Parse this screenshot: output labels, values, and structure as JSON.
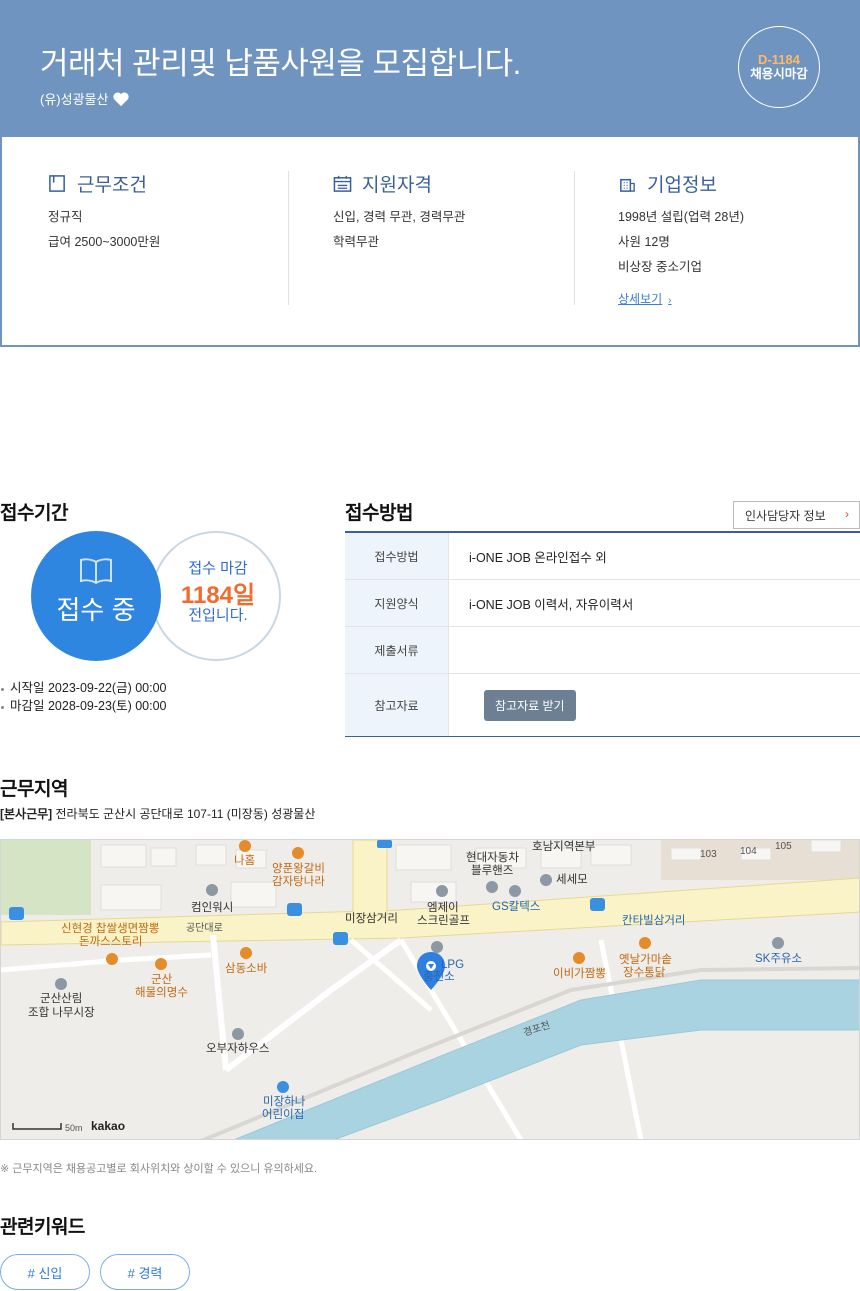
{
  "header": {
    "title": "거래처 관리및 납품사원을 모집합니다.",
    "company": "(유)성광물산",
    "dday": "D-1184",
    "dday_label": "채용시마감"
  },
  "summary": {
    "conditions": {
      "title": "근무조건",
      "lines": [
        "정규직",
        "급여 2500~3000만원"
      ]
    },
    "qualification": {
      "title": "지원자격",
      "lines": [
        "신입, 경력 무관, 경력무관",
        "학력무관"
      ]
    },
    "company_info": {
      "title": "기업정보",
      "lines": [
        "1998년 설립(업력 28년)",
        "사원 12명",
        "비상장 중소기업"
      ],
      "more": "상세보기"
    }
  },
  "period": {
    "title": "접수기간",
    "status": "접수 중",
    "deadline_line1": "접수 마감",
    "deadline_days": "1184일",
    "deadline_line3": "전입니다.",
    "start": "시작일 2023-09-22(금) 00:00",
    "end": "마감일 2028-09-23(토) 00:00"
  },
  "method": {
    "title": "접수방법",
    "hr_button": "인사담당자 정보",
    "rows": [
      {
        "label": "접수방법",
        "value": "i-ONE JOB 온라인접수 외"
      },
      {
        "label": "지원양식",
        "value": "i-ONE JOB 이력서, 자유이력서"
      },
      {
        "label": "제출서류",
        "value": ""
      },
      {
        "label": "참고자료",
        "button": "참고자료 받기"
      }
    ]
  },
  "location": {
    "title": "근무지역",
    "tag": "[본사근무]",
    "address": "전라북도 군산시 공단대로 107-11 (미장동) 성광물산",
    "note": "※ 근무지역은 채용공고별로 회사위치와 상이할 수 있으니 유의하세요.",
    "map": {
      "labels": {
        "nahom": "나홈",
        "yangpung": "양푼왕갈비",
        "gamjatang": "감자탕나라",
        "hyundai": "현대자동차",
        "bluehands": "블루핸즈",
        "honam": "호남지역본부",
        "bld103": "103",
        "bld104": "104",
        "bld105": "105",
        "sesemo": "세세모",
        "computer": "컴인워시",
        "mijang_sam": "미장삼거리",
        "mjgolf1": "엠제이",
        "mjgolf2": "스크린골프",
        "gscaltex": "GS칼텍스",
        "kantabil": "칸타빌삼거리",
        "shinhyun1": "신현경 찹쌀생면짬뽕",
        "shinhyun2": "돈까스스토리",
        "gongdan": "공단대로",
        "samdong": "삼동소바",
        "lpg1": "LPG",
        "lpg2": "충전소",
        "ibiga": "이비가짬뽕",
        "yetnal1": "옛날가마솥",
        "yetnal2": "장수통닭",
        "sk": "SK주유소",
        "gunsan1": "군산",
        "gunsan2": "해물의명수",
        "sanrim1": "군산산림",
        "sanrim2": "조합 나무시장",
        "gyeongpo": "경포천",
        "obuja": "오부자하우스",
        "mijangha1": "미장하나",
        "mijangha2": "어린이집",
        "scale": "50m",
        "brand": "kakao"
      }
    }
  },
  "keywords": {
    "title": "관련키워드",
    "items": [
      "# 신입",
      "# 경력"
    ]
  },
  "colors": {
    "hero": "#7094c0",
    "accent_blue": "#2f86e0",
    "accent_orange": "#f36a2e",
    "dday_orange": "#ffb86b"
  }
}
